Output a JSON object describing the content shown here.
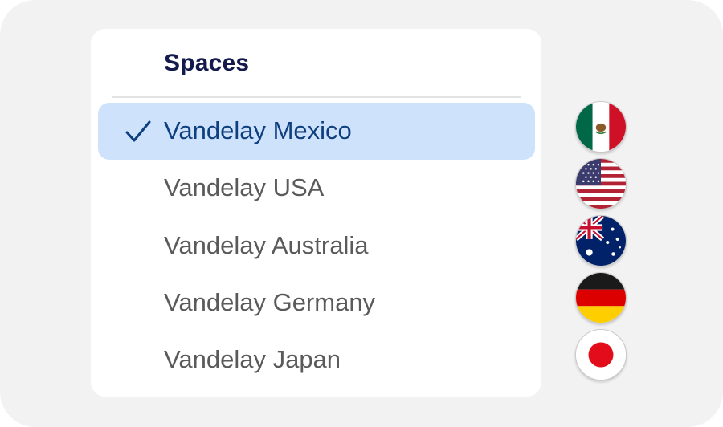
{
  "menu": {
    "title": "Spaces",
    "items": [
      {
        "label": "Vandelay Mexico",
        "selected": true,
        "flag": "mexico-flag-icon"
      },
      {
        "label": "Vandelay USA",
        "selected": false,
        "flag": "usa-flag-icon"
      },
      {
        "label": "Vandelay Australia",
        "selected": false,
        "flag": "australia-flag-icon"
      },
      {
        "label": "Vandelay Germany",
        "selected": false,
        "flag": "germany-flag-icon"
      },
      {
        "label": "Vandelay Japan",
        "selected": false,
        "flag": "japan-flag-icon"
      }
    ],
    "selected_icon": "checkmark-icon"
  },
  "colors": {
    "selected_bg": "#cfe2fc",
    "selected_text": "#0e3f7e",
    "title_text": "#141a4c",
    "item_text": "#5a5a5a"
  }
}
